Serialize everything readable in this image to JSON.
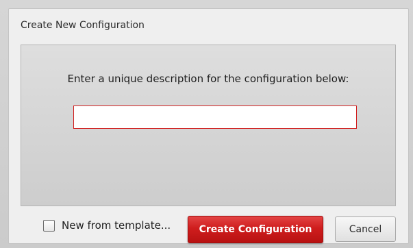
{
  "dialog": {
    "title": "Create New Configuration",
    "prompt": "Enter a unique description for the configuration below:",
    "description_input": {
      "value": "",
      "placeholder": ""
    },
    "template_checkbox": {
      "label": "New from template...",
      "checked": false
    },
    "create_button_label": "Create Configuration",
    "cancel_button_label": "Cancel"
  },
  "colors": {
    "accent_red": "#cf1d1d",
    "input_border": "#d11f1f",
    "panel_bg": "#d4d4d4"
  }
}
